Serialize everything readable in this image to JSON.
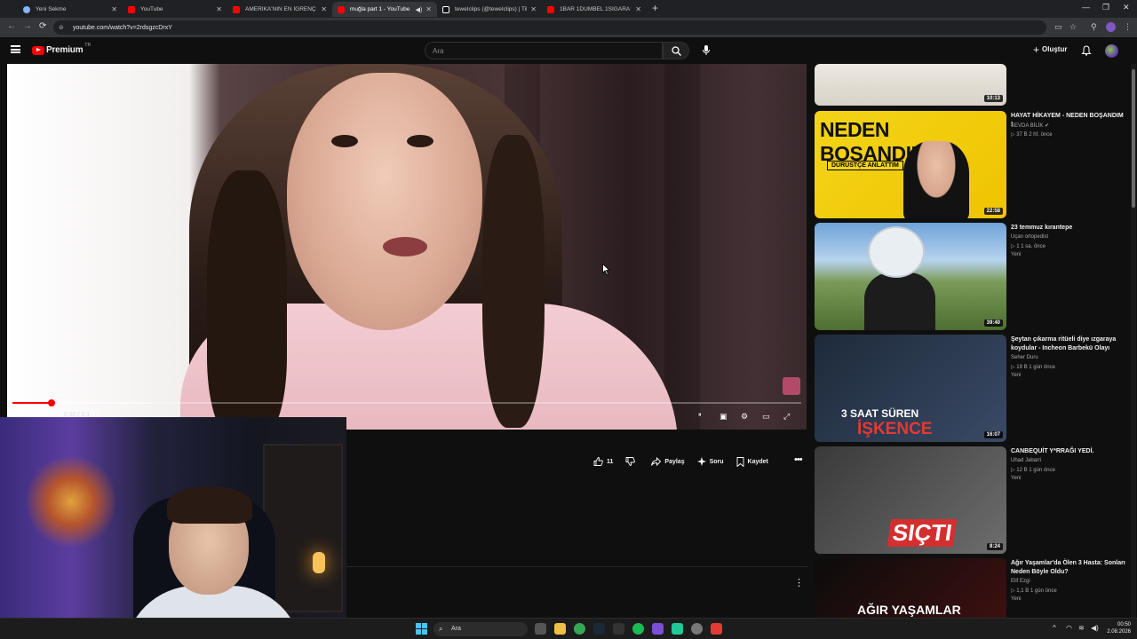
{
  "browser": {
    "tabs": [
      {
        "title": "Yeni Sekme",
        "color": "#8ab4f8",
        "active": false
      },
      {
        "title": "YouTube",
        "color": "#ff0000",
        "active": false
      },
      {
        "title": "AMERİKA'NIN EN İĞRENÇ PROJE",
        "color": "#ff0000",
        "active": false
      },
      {
        "title": "muğla part 1 - YouTube",
        "color": "#ff0000",
        "active": true
      },
      {
        "title": "teweIclips (@teweIclips) | TikTok",
        "color": "#ffffff",
        "active": false
      },
      {
        "title": "1BAR 1DUMBEL 1SİGARA w/ @",
        "color": "#ff0000",
        "active": false
      }
    ],
    "url": "youtube.com/watch?v=2rdsgzcDrxY"
  },
  "masthead": {
    "logo_text": "Premium",
    "country_code": "TR",
    "search_placeholder": "Ara",
    "create_label": "Oluştur"
  },
  "player": {
    "time_text": "0:32 / 1:1",
    "progress_played": 0.05,
    "progress_buffered": 0.17
  },
  "actions": {
    "like_count": "11",
    "share_label": "Paylaş",
    "ask_label": "Soru",
    "save_label": "Kaydet"
  },
  "recommendations": [
    {
      "title": "",
      "channel": "",
      "meta": "",
      "badge": "",
      "duration": "10:13"
    },
    {
      "title": "HAYAT HİKAYEM - NEDEN BOŞANDIM !",
      "channel": "SEVDA BİLİK ✔",
      "meta": "▷ 37 B  2 hf. önce",
      "badge": "",
      "duration": "22:58",
      "thumb_text": "NEDEN BOŞANDIM?",
      "thumb_sub": "DÜRÜSTÇE ANLATTIM"
    },
    {
      "title": "23 temmuz kırantepe",
      "channel": "Uçan ortopedist",
      "meta": "▷ 1  1 sa. önce",
      "badge": "Yeni",
      "duration": "39:40"
    },
    {
      "title": "Şeytan çıkarma ritüeli diye ızgaraya koydular - Incheon Barbekü Olayı",
      "channel": "Seher Duru",
      "meta": "▷ 19 B  1 gün önce",
      "badge": "Yeni",
      "duration": "16:07",
      "thumb_text": "3 SAAT SÜREN",
      "thumb_sub": "İŞKENCE"
    },
    {
      "title": "CANBEQUİT Y*RRAĞI YEDİ.",
      "channel": "Uhad Jabarri",
      "meta": "▷ 12 B  1 gün önce",
      "badge": "Yeni",
      "duration": "8:24",
      "thumb_text": "SIÇTI"
    },
    {
      "title": "Ağır Yaşamlar'da Ölen 3 Hasta: Sonları Neden Böyle Oldu?",
      "channel": "Elif Ezgi",
      "meta": "▷ 1,1 B  1 gün önce",
      "badge": "Yeni",
      "duration": "",
      "thumb_text": "AĞIR YAŞAMLAR"
    }
  ],
  "taskbar": {
    "search_label": "Ara",
    "time": "00:50",
    "date": "2.08.2026"
  },
  "icons": {
    "back": "←",
    "forward": "→",
    "reload": "⟳",
    "cursor": "arrow-pointer-icon"
  },
  "colors": {
    "yt_red": "#ff0000",
    "background": "#0f0f0f",
    "taskbar": "#1c1c1c"
  }
}
